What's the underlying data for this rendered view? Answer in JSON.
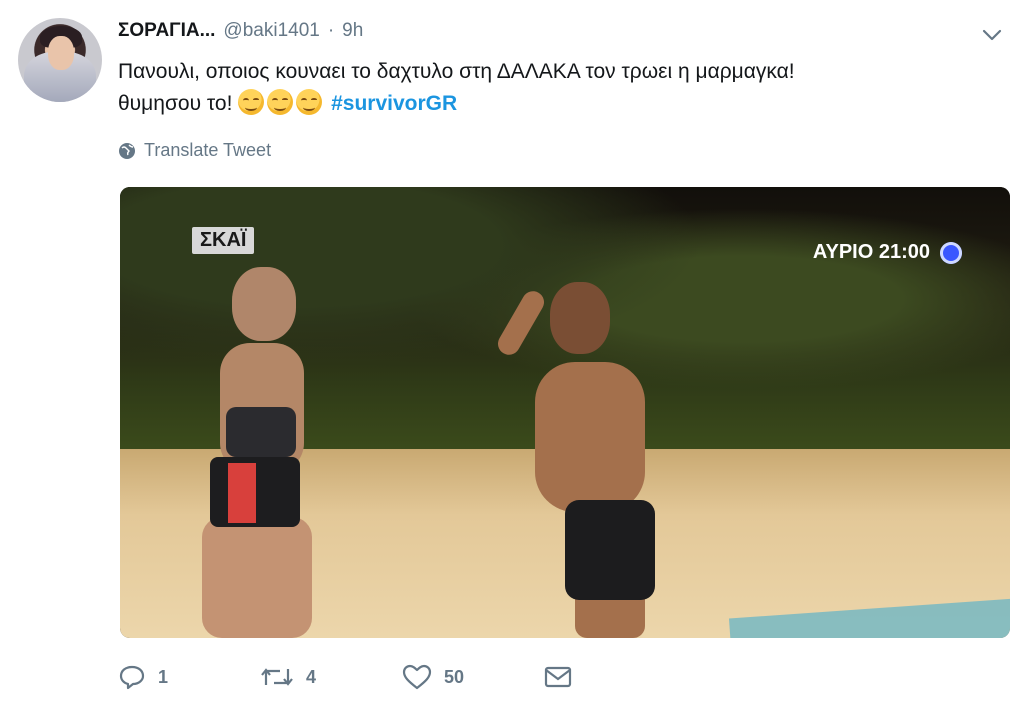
{
  "user": {
    "display_name": "ΣΟΡΑΓΙΑ...",
    "screen_name": "@baki1401",
    "separator": "·",
    "time": "9h"
  },
  "tweet": {
    "line1": "Πανουλι, οποιος κουναει το δαχτυλο στη ΔΑΛΑΚΑ τον τρωει η μαρμαγκα!",
    "line2_prefix": "θυμησου το!",
    "hashtag": "#survivorGR",
    "emoji_count": 3
  },
  "translate": {
    "label": "Translate Tweet",
    "icon": "globe-icon"
  },
  "media": {
    "channel_logo": "ΣΚΑΪ",
    "airtime": "ΑΥΡΙΟ 21:00"
  },
  "actions": {
    "reply_count": "1",
    "retweet_count": "4",
    "like_count": "50"
  },
  "colors": {
    "link": "#1b95e0",
    "muted": "#657786",
    "text": "#14171a"
  }
}
